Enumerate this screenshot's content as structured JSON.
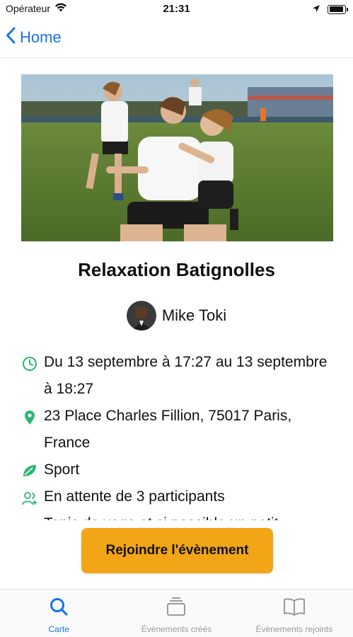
{
  "status_bar": {
    "carrier": "Opérateur",
    "time": "21:31",
    "battery_level": 0.95
  },
  "nav": {
    "back_label": "Home",
    "accent": "#1a73e8"
  },
  "event": {
    "title": "Relaxation Batignolles",
    "organizer": "Mike Toki",
    "details": [
      {
        "icon": "clock-icon",
        "text": "Du 13 septembre à 17:27 au 13 septembre à 18:27"
      },
      {
        "icon": "location-pin-icon",
        "text": "23 Place Charles Fillion, 75017 Paris, France"
      },
      {
        "icon": "leaf-icon",
        "text": "Sport"
      },
      {
        "icon": "users-icon",
        "text": "En attente de 3 participants"
      },
      {
        "icon": "",
        "text": "Tapis de yoga et si possible un petit"
      }
    ],
    "icon_color": "#2bb673"
  },
  "actions": {
    "join_label": "Rejoindre l'évènement",
    "join_color": "#f2a516"
  },
  "tab_bar": {
    "tabs": [
      {
        "label": "Carte",
        "icon": "search-icon",
        "active": true
      },
      {
        "label": "Évènements créés",
        "icon": "stack-icon",
        "active": false
      },
      {
        "label": "Évènements rejoints",
        "icon": "book-icon",
        "active": false
      }
    ]
  }
}
